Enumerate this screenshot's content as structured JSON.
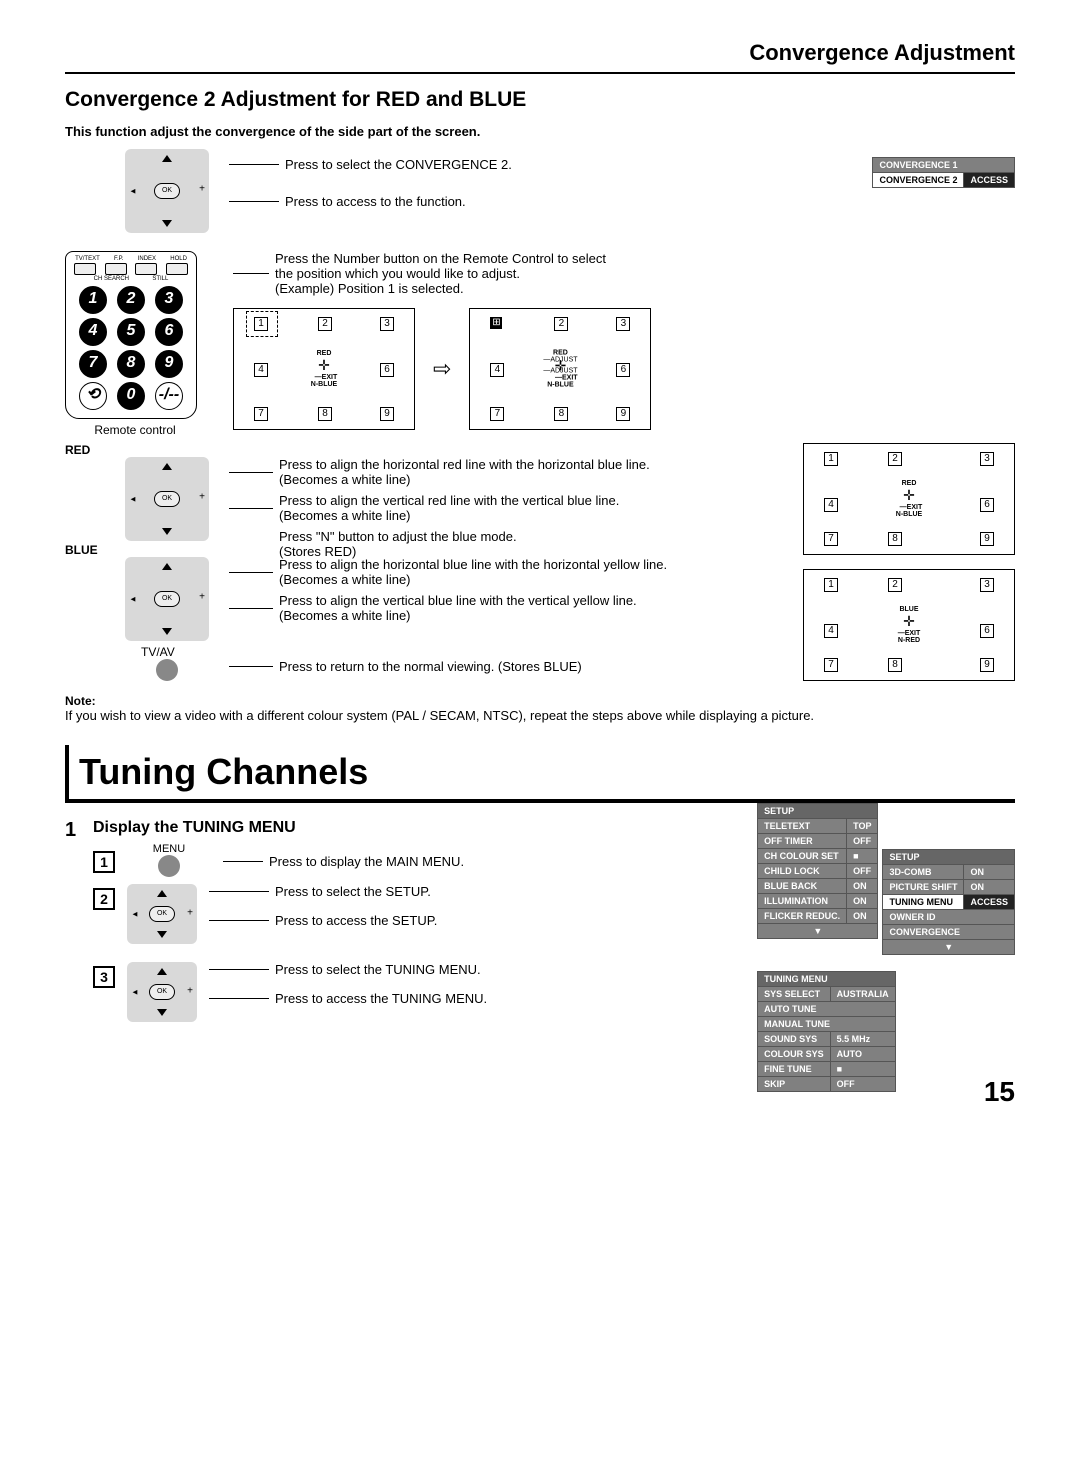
{
  "header": {
    "pageTitle": "Convergence Adjustment"
  },
  "conv2": {
    "title": "Convergence 2 Adjustment for RED and BLUE",
    "intro": "This function adjust the convergence of the side part of the screen.",
    "step_select": "Press to select the CONVERGENCE 2.",
    "step_access": "Press to access to the function.",
    "remote_caption": "Remote control",
    "press_number_1": "Press the Number button on the Remote Control to select",
    "press_number_2": "the position which you would like to adjust.",
    "press_number_ex": "(Example) Position 1 is selected.",
    "red_label": "RED",
    "red_h": "Press to align the horizontal red line with the horizontal blue line.",
    "red_h2": "(Becomes a white line)",
    "red_v": "Press to align the vertical red line with the vertical blue line.",
    "red_v2": "(Becomes a white line)",
    "n_btn": "Press \"N\" button to adjust the blue mode.",
    "n_btn2": "(Stores RED)",
    "blue_label": "BLUE",
    "blue_h": "Press to align the horizontal blue line with the horizontal yellow line.",
    "blue_h2": "(Becomes a white line)",
    "blue_v": "Press to align the vertical blue line with the vertical yellow line.",
    "blue_v2": "(Becomes a white line)",
    "tvav_label": "TV/AV",
    "tvav_instr": "Press to return to the normal viewing. (Stores BLUE)",
    "note_label": "Note:",
    "note_body": "If you wish to view a video with a different colour system (PAL / SECAM, NTSC), repeat the steps above while displaying a picture.",
    "convergence_menu": {
      "row1": "CONVERGENCE 1",
      "row2_l": "CONVERGENCE 2",
      "row2_r": "ACCESS"
    },
    "grid_center": {
      "red": "RED",
      "exit": "EXIT",
      "nblue": "N-BLUE",
      "adjust": "ADJUST",
      "blue": "BLUE",
      "nred": "N-RED"
    },
    "grid_nums": {
      "1": "1",
      "2": "2",
      "3": "3",
      "4": "4",
      "6": "6",
      "7": "7",
      "8": "8",
      "9": "9"
    }
  },
  "tuning": {
    "title": "Tuning Channels",
    "display_title": "Display the TUNING MENU",
    "step1_num": "1",
    "menu_label": "MENU",
    "menu_instr": "Press to display the MAIN MENU.",
    "setup_sel": "Press to select the SETUP.",
    "setup_acc": "Press to access the SETUP.",
    "tuning_sel": "Press to select the TUNING MENU.",
    "tuning_acc": "Press to access the TUNING MENU.",
    "setup_osd": {
      "header": "SETUP",
      "rows": [
        [
          "TELETEXT",
          "TOP"
        ],
        [
          "OFF TIMER",
          "OFF"
        ],
        [
          "CH COLOUR SET",
          "■"
        ],
        [
          "CHILD LOCK",
          "OFF"
        ],
        [
          "BLUE BACK",
          "ON"
        ],
        [
          "ILLUMINATION",
          "ON"
        ],
        [
          "FLICKER REDUC.",
          "ON"
        ],
        [
          "▼",
          ""
        ]
      ]
    },
    "setup2_osd": {
      "header": "SETUP",
      "rows": [
        [
          "3D-COMB",
          "ON"
        ],
        [
          "PICTURE SHIFT",
          "ON"
        ],
        [
          "TUNING MENU",
          "ACCESS"
        ],
        [
          "OWNER ID",
          ""
        ],
        [
          "CONVERGENCE",
          ""
        ],
        [
          "▼",
          ""
        ]
      ]
    },
    "tuning_osd": {
      "header": "TUNING MENU",
      "rows": [
        [
          "SYS SELECT",
          "AUSTRALIA"
        ],
        [
          "AUTO TUNE",
          ""
        ],
        [
          "MANUAL TUNE",
          ""
        ],
        [
          "SOUND  SYS",
          "5.5 MHz"
        ],
        [
          "COLOUR  SYS",
          "AUTO"
        ],
        [
          "FINE  TUNE",
          "■"
        ],
        [
          "SKIP",
          "OFF"
        ]
      ]
    }
  },
  "remote_labels": {
    "top": [
      "TV/TEXT",
      "F.P.",
      "INDEX",
      "HOLD"
    ],
    "mid": [
      "CH SEARCH",
      "STILL"
    ]
  },
  "page_number": "15",
  "ok_label": "OK"
}
